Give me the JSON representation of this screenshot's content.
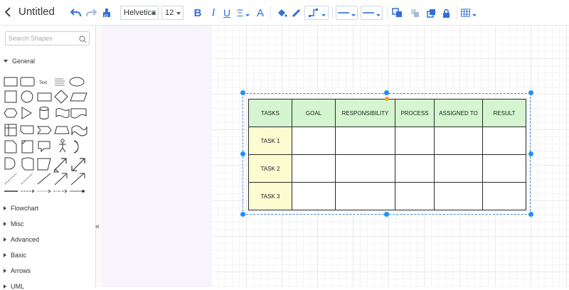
{
  "app": {
    "title": "Untitled"
  },
  "toolbar": {
    "font_family": "Helvetica",
    "font_size": "12",
    "bold": "B",
    "italic": "I",
    "underline": "U",
    "align": "Ξ",
    "font_color": "A",
    "accent_color": "#2f6fdc"
  },
  "sidebar": {
    "search_placeholder": "Search Shapes",
    "sections": [
      {
        "label": "General",
        "expanded": true
      },
      {
        "label": "Flowchart",
        "expanded": false
      },
      {
        "label": "Misc",
        "expanded": false
      },
      {
        "label": "Advanced",
        "expanded": false
      },
      {
        "label": "Basic",
        "expanded": false
      },
      {
        "label": "Arrows",
        "expanded": false
      },
      {
        "label": "UML",
        "expanded": false
      }
    ],
    "shape_text_label": "Text",
    "collapse_glyph": "«"
  },
  "table": {
    "headers": [
      "TASKS",
      "GOAL",
      "RESPONSIBILITY",
      "PROCESS",
      "ASSIGNED TO",
      "RESULT"
    ],
    "rows": [
      [
        "TASK 1",
        "",
        "",
        "",
        "",
        ""
      ],
      [
        "TASK 2",
        "",
        "",
        "",
        "",
        ""
      ],
      [
        "TASK 3",
        "",
        "",
        "",
        "",
        ""
      ]
    ],
    "header_color": "#d4f5cf",
    "first_col_color": "#fbfcd0"
  }
}
